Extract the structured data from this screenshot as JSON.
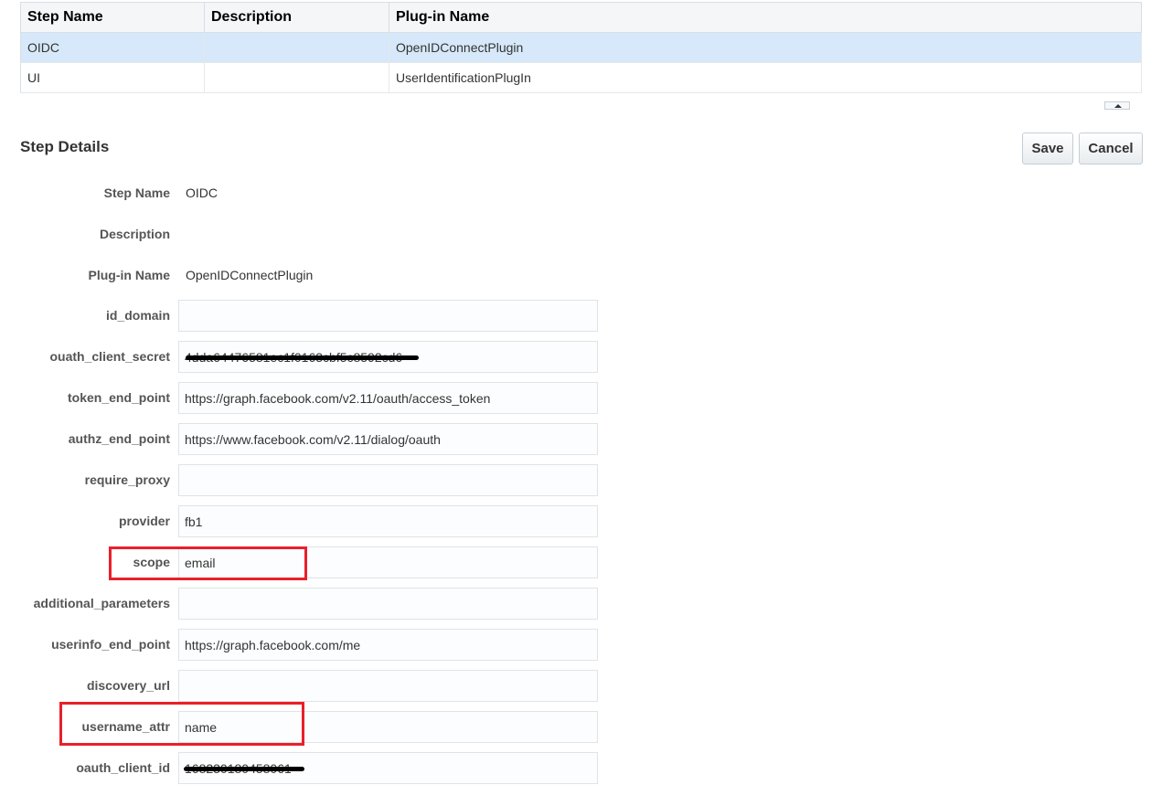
{
  "table": {
    "headers": [
      "Step Name",
      "Description",
      "Plug-in Name"
    ],
    "rows": [
      {
        "step": "OIDC",
        "description": "",
        "plugin": "OpenIDConnectPlugin",
        "selected": true
      },
      {
        "step": "UI",
        "description": "",
        "plugin": "UserIdentificationPlugIn",
        "selected": false
      }
    ]
  },
  "details": {
    "title": "Step Details",
    "save_label": "Save",
    "cancel_label": "Cancel",
    "step_name_label": "Step Name",
    "step_name_value": "OIDC",
    "description_label": "Description",
    "description_value": "",
    "plugin_label": "Plug-in Name",
    "plugin_value": "OpenIDConnectPlugin"
  },
  "fields": [
    {
      "label": "id_domain",
      "value": ""
    },
    {
      "label": "ouath_client_secret",
      "value": "4dda64476581ec1f0163cbf5c8592cd6"
    },
    {
      "label": "token_end_point",
      "value": "https://graph.facebook.com/v2.11/oauth/access_token"
    },
    {
      "label": "authz_end_point",
      "value": "https://www.facebook.com/v2.11/dialog/oauth"
    },
    {
      "label": "require_proxy",
      "value": ""
    },
    {
      "label": "provider",
      "value": "fb1"
    },
    {
      "label": "scope",
      "value": "email"
    },
    {
      "label": "additional_parameters",
      "value": ""
    },
    {
      "label": "userinfo_end_point",
      "value": "https://graph.facebook.com/me"
    },
    {
      "label": "discovery_url",
      "value": ""
    },
    {
      "label": "username_attr",
      "value": "name"
    },
    {
      "label": "oauth_client_id",
      "value": "168230180458061"
    }
  ],
  "colors": {
    "highlight": "#e8202a",
    "selected_row": "#d6e8f9"
  }
}
